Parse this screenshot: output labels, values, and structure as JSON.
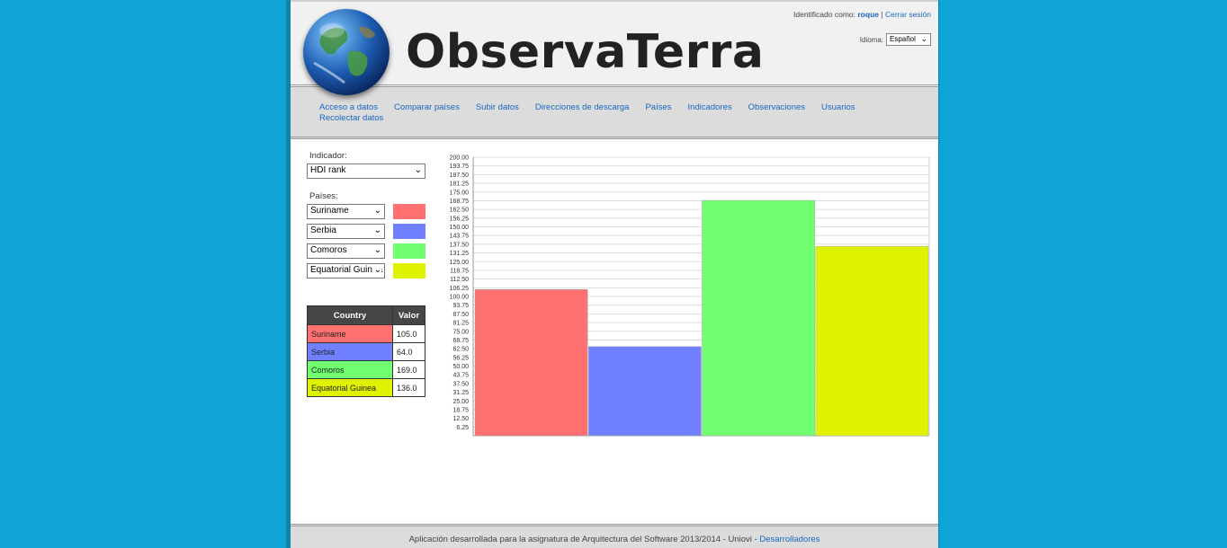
{
  "header": {
    "title": "ObservaTerra",
    "identified_label": "Identificado como:",
    "username": "roque",
    "separator": "|",
    "logout": "Cerrar sesión",
    "language_label": "Idioma:",
    "language_value": "Español"
  },
  "nav": {
    "items": [
      "Acceso a datos",
      "Comparar países",
      "Subir datos",
      "Direcciones de descarga",
      "Países",
      "Indicadores",
      "Observaciones",
      "Usuarios",
      "Recolectar datos"
    ]
  },
  "form": {
    "indicator_label": "Indicador:",
    "indicator_value": "HDI rank",
    "countries_label": "Países:",
    "countries": [
      {
        "name": "Suriname",
        "color": "#ff7070"
      },
      {
        "name": "Serbia",
        "color": "#7080ff"
      },
      {
        "name": "Comoros",
        "color": "#70ff70"
      },
      {
        "name": "Equatorial Guinea",
        "color": "#dff200"
      }
    ]
  },
  "table": {
    "col_country": "Country",
    "col_value": "Valor",
    "rows": [
      {
        "country": "Suriname",
        "value": "105.0"
      },
      {
        "country": "Serbia",
        "value": "64.0"
      },
      {
        "country": "Comoros",
        "value": "169.0"
      },
      {
        "country": "Equatorial Guinea",
        "value": "136.0"
      }
    ]
  },
  "chart_data": {
    "type": "bar",
    "categories": [
      "Suriname",
      "Serbia",
      "Comoros",
      "Equatorial Guinea"
    ],
    "values": [
      105,
      64,
      169,
      136
    ],
    "colors": [
      "#ff7070",
      "#7080ff",
      "#70ff70",
      "#dff200"
    ],
    "ylim": [
      0,
      200
    ],
    "ytick_step": 6.25,
    "ytick_labels": [
      "6.25",
      "12.50",
      "18.75",
      "25.00",
      "31.25",
      "37.50",
      "43.75",
      "50.00",
      "56.25",
      "62.50",
      "68.75",
      "75.00",
      "81.25",
      "87.50",
      "93.75",
      "100.00",
      "106.25",
      "112.50",
      "118.75",
      "125.00",
      "131.25",
      "137.50",
      "143.75",
      "150.00",
      "156.25",
      "162.50",
      "168.75",
      "175.00",
      "181.25",
      "187.50",
      "193.75",
      "200.00"
    ],
    "grid": true,
    "title": "",
    "xlabel": "",
    "ylabel": ""
  },
  "footer": {
    "text": "Aplicación desarrollada para la asignatura de Arquitectura del Software 2013/2014 - Uniovi -",
    "link": "Desarrolladores"
  }
}
